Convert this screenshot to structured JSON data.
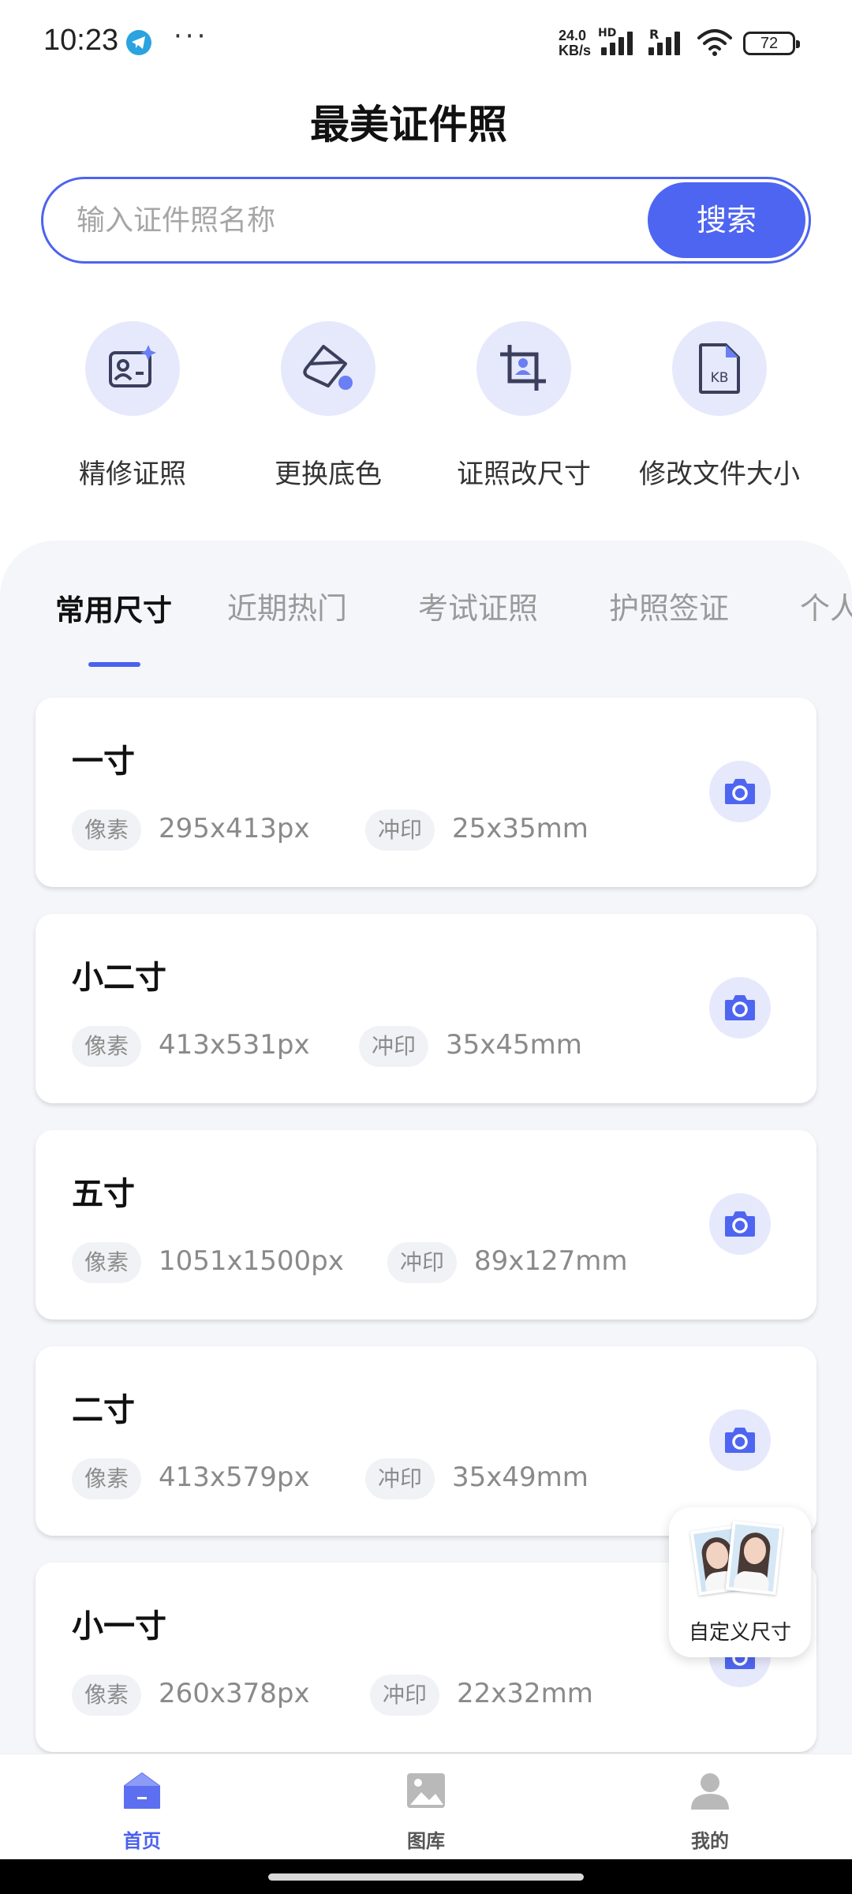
{
  "status_bar": {
    "time": "10:23",
    "dots": "···",
    "net_speed_value": "24.0",
    "net_speed_unit": "KB/s",
    "hd_label": "HD",
    "roaming_label": "R",
    "battery": "72"
  },
  "header": {
    "title": "最美证件照",
    "search_placeholder": "输入证件照名称",
    "search_button": "搜索"
  },
  "tools": [
    {
      "label": "精修证照",
      "icon": "portrait-sparkle-icon"
    },
    {
      "label": "更换底色",
      "icon": "paint-bucket-icon"
    },
    {
      "label": "证照改尺寸",
      "icon": "crop-icon"
    },
    {
      "label": "修改文件大小",
      "icon": "kb-file-icon"
    }
  ],
  "tabs": [
    "常用尺寸",
    "近期热门",
    "考试证照",
    "护照签证",
    "个人"
  ],
  "active_tab": 0,
  "cards": [
    {
      "title": "一寸",
      "pixel_label": "像素",
      "pixel_value": "295x413px",
      "print_label": "冲印",
      "print_value": "25x35mm"
    },
    {
      "title": "小二寸",
      "pixel_label": "像素",
      "pixel_value": "413x531px",
      "print_label": "冲印",
      "print_value": "35x45mm"
    },
    {
      "title": "五寸",
      "pixel_label": "像素",
      "pixel_value": "1051x1500px",
      "print_label": "冲印",
      "print_value": "89x127mm"
    },
    {
      "title": "二寸",
      "pixel_label": "像素",
      "pixel_value": "413x579px",
      "print_label": "冲印",
      "print_value": "35x49mm"
    },
    {
      "title": "小一寸",
      "pixel_label": "像素",
      "pixel_value": "260x378px",
      "print_label": "冲印",
      "print_value": "22x32mm"
    }
  ],
  "float_button": {
    "label": "自定义尺寸"
  },
  "bottom_nav": [
    {
      "label": "首页",
      "icon": "home-icon",
      "active": true
    },
    {
      "label": "图库",
      "icon": "gallery-icon",
      "active": false
    },
    {
      "label": "我的",
      "icon": "profile-icon",
      "active": false
    }
  ],
  "colors": {
    "accent": "#4e65f2",
    "icon_bg": "#e6e9fb",
    "panel_bg": "#f4f6fa"
  }
}
